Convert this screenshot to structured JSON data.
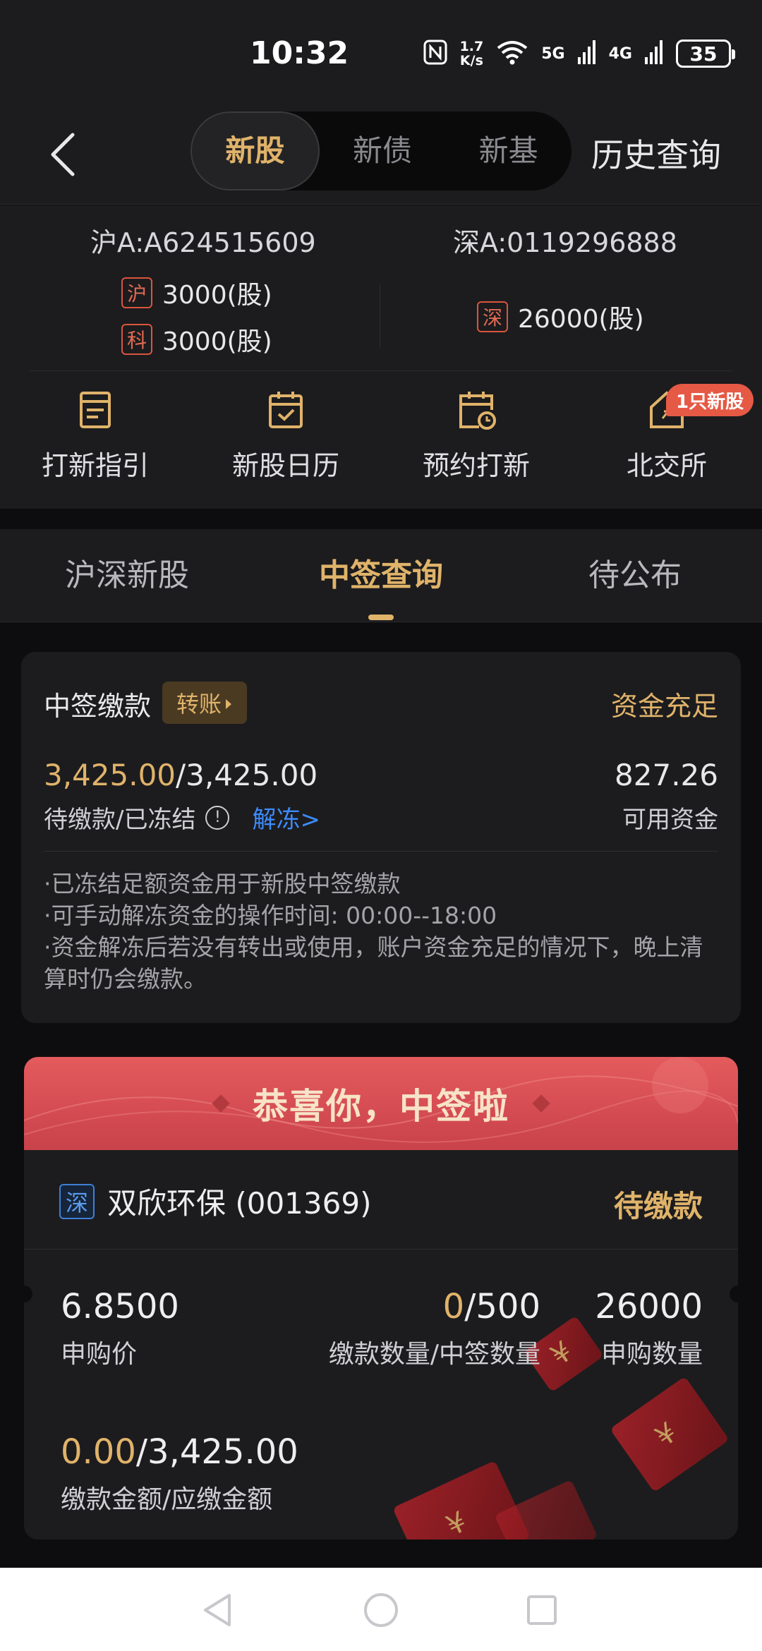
{
  "status_bar": {
    "time": "10:32",
    "net_speed_top": "1.7",
    "net_speed_bottom": "K/s",
    "net1": "5G",
    "net2": "4G",
    "battery": "35"
  },
  "header": {
    "segments": [
      "新股",
      "新债",
      "新基"
    ],
    "active_segment": 0,
    "history": "历史查询"
  },
  "account": {
    "sh_label": "沪A:A624515609",
    "sz_label": "深A:0119296888",
    "quotas": [
      {
        "tag": "沪",
        "value": "3000(股)"
      },
      {
        "tag": "科",
        "value": "3000(股)"
      },
      {
        "tag": "深",
        "value": "26000(股)"
      }
    ]
  },
  "shortcuts": [
    {
      "label": "打新指引",
      "icon": "guide-doc-icon"
    },
    {
      "label": "新股日历",
      "icon": "calendar-check-icon"
    },
    {
      "label": "预约打新",
      "icon": "calendar-clock-icon"
    },
    {
      "label": "北交所",
      "icon": "house-exchange-icon"
    }
  ],
  "badge": "1只新股",
  "tabs": [
    "沪深新股",
    "中签查询",
    "待公布"
  ],
  "active_tab": 1,
  "payment": {
    "title": "中签缴款",
    "transfer": "转账",
    "status": "资金充足",
    "pending": "3,425.00",
    "frozen": "/3,425.00",
    "amount_label": "待缴款/已冻结",
    "unfreeze": "解冻>",
    "available": "827.26",
    "available_label": "可用资金",
    "notes": [
      "·已冻结足额资金用于新股中签缴款",
      "·可手动解冻资金的操作时间: 00:00--18:00",
      "·资金解冻后若没有转出或使用，账户资金充足的情况下，晚上清算时仍会缴款。"
    ]
  },
  "win": {
    "banner": "恭喜你，中签啦",
    "market_tag": "深",
    "stock": "双欣环保 (001369)",
    "status": "待缴款",
    "price": "6.8500",
    "price_label": "申购价",
    "paid_qty": "0",
    "won_qty": "/500",
    "qty_label": "缴款数量/中签数量",
    "apply_qty": "26000",
    "apply_label": "申购数量",
    "paid_amt": "0.00",
    "due_amt": "/3,425.00",
    "amt_label": "缴款金额/应缴金额"
  },
  "colors": {
    "accent": "#e0b36a",
    "link": "#3d8bfd",
    "banner": "#d74b50",
    "tag_red": "#d9553f"
  }
}
